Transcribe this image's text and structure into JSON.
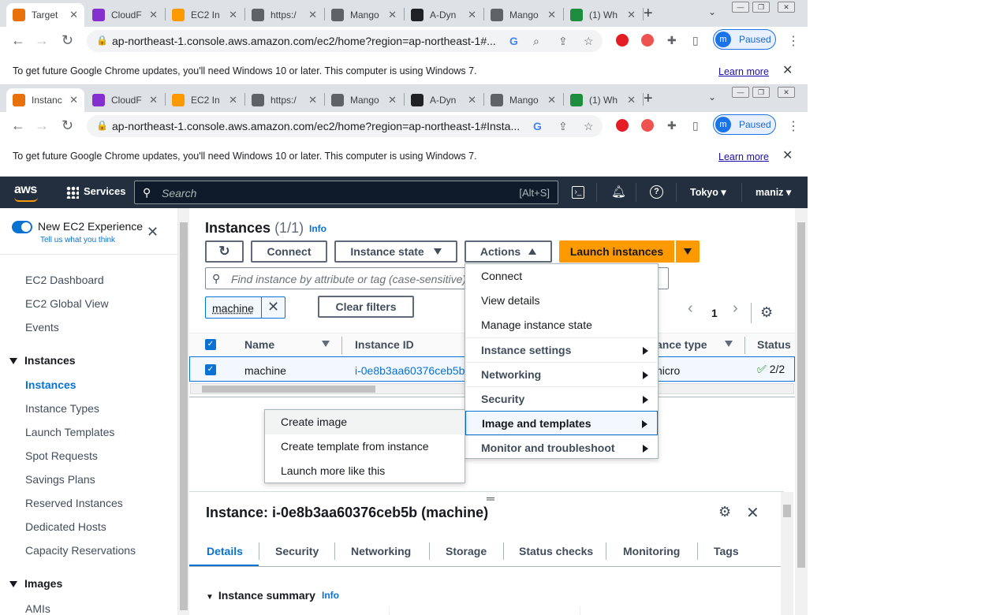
{
  "browser_top": {
    "tabs": [
      {
        "title": "Target",
        "color": "#e8710a",
        "active": true
      },
      {
        "title": "CloudF",
        "color": "#8430ce"
      },
      {
        "title": "EC2 In",
        "color": "#ff9900"
      },
      {
        "title": "https:/",
        "color": "#5f6368"
      },
      {
        "title": "Mango",
        "color": "#5f6368"
      },
      {
        "title": "A-Dyn",
        "color": "#202124"
      },
      {
        "title": "Mango",
        "color": "#5f6368"
      },
      {
        "title": "(1) Wh",
        "color": "#1e8e3e"
      }
    ],
    "url": "ap-northeast-1.console.aws.amazon.com/ec2/home?region=ap-northeast-1#...",
    "profile_initial": "m",
    "profile_status": "Paused"
  },
  "browser_second": {
    "tabs": [
      {
        "title": "Instanc",
        "color": "#e8710a",
        "active": true
      },
      {
        "title": "CloudF",
        "color": "#8430ce"
      },
      {
        "title": "EC2 In",
        "color": "#ff9900"
      },
      {
        "title": "https:/",
        "color": "#5f6368"
      },
      {
        "title": "Mango",
        "color": "#5f6368"
      },
      {
        "title": "A-Dyn",
        "color": "#202124"
      },
      {
        "title": "Mango",
        "color": "#5f6368"
      },
      {
        "title": "(1) Wh",
        "color": "#1e8e3e"
      }
    ],
    "url": "ap-northeast-1.console.aws.amazon.com/ec2/home?region=ap-northeast-1#Insta...",
    "profile_initial": "m",
    "profile_status": "Paused"
  },
  "infobar": {
    "message": "To get future Google Chrome updates, you'll need Windows 10 or later. This computer is using Windows 7.",
    "learn_more": "Learn more"
  },
  "aws_nav": {
    "logo": "aws",
    "services": "Services",
    "search_placeholder": "Search",
    "search_shortcut": "[Alt+S]",
    "region": "Tokyo",
    "user": "maniz"
  },
  "sidebar": {
    "new_experience": "New EC2 Experience",
    "tell_us": "Tell us what you think",
    "items_top": [
      "EC2 Dashboard",
      "EC2 Global View",
      "Events"
    ],
    "group_instances": "Instances",
    "instances_items": [
      "Instances",
      "Instance Types",
      "Launch Templates",
      "Spot Requests",
      "Savings Plans",
      "Reserved Instances",
      "Dedicated Hosts",
      "Capacity Reservations"
    ],
    "group_images": "Images",
    "images_items": [
      "AMIs"
    ]
  },
  "main": {
    "title": "Instances",
    "count": "(1/1)",
    "info": "Info",
    "btn_connect": "Connect",
    "btn_state": "Instance state",
    "btn_actions": "Actions",
    "btn_launch": "Launch instances",
    "find_placeholder": "Find instance by attribute or tag (case-sensitive)",
    "filter_token": "machine",
    "clear_filters": "Clear filters",
    "page_num": "1",
    "columns": [
      "Name",
      "Instance ID",
      "ance type",
      "Status"
    ],
    "row": {
      "name": "machine",
      "id": "i-0e8b3aa60376ceb5b",
      "type": "nicro",
      "status": "2/2"
    }
  },
  "actions_menu": {
    "items": [
      {
        "label": "Connect",
        "kind": "plain"
      },
      {
        "label": "View details",
        "kind": "plain"
      },
      {
        "label": "Manage instance state",
        "kind": "plain"
      },
      {
        "label": "Instance settings",
        "kind": "sub"
      },
      {
        "label": "Networking",
        "kind": "sub"
      },
      {
        "label": "Security",
        "kind": "sub"
      },
      {
        "label": "Image and templates",
        "kind": "sub-selected"
      },
      {
        "label": "Monitor and troubleshoot",
        "kind": "sub"
      }
    ]
  },
  "submenu": {
    "items": [
      "Create image",
      "Create template from instance",
      "Launch more like this"
    ]
  },
  "detail": {
    "title": "Instance: i-0e8b3aa60376ceb5b (machine)",
    "tabs": [
      "Details",
      "Security",
      "Networking",
      "Storage",
      "Status checks",
      "Monitoring",
      "Tags"
    ],
    "section": "Instance summary",
    "info": "Info"
  },
  "colors": {
    "aws_nav": "#232f3e",
    "orange": "#ff9900",
    "link": "#0972d3"
  }
}
